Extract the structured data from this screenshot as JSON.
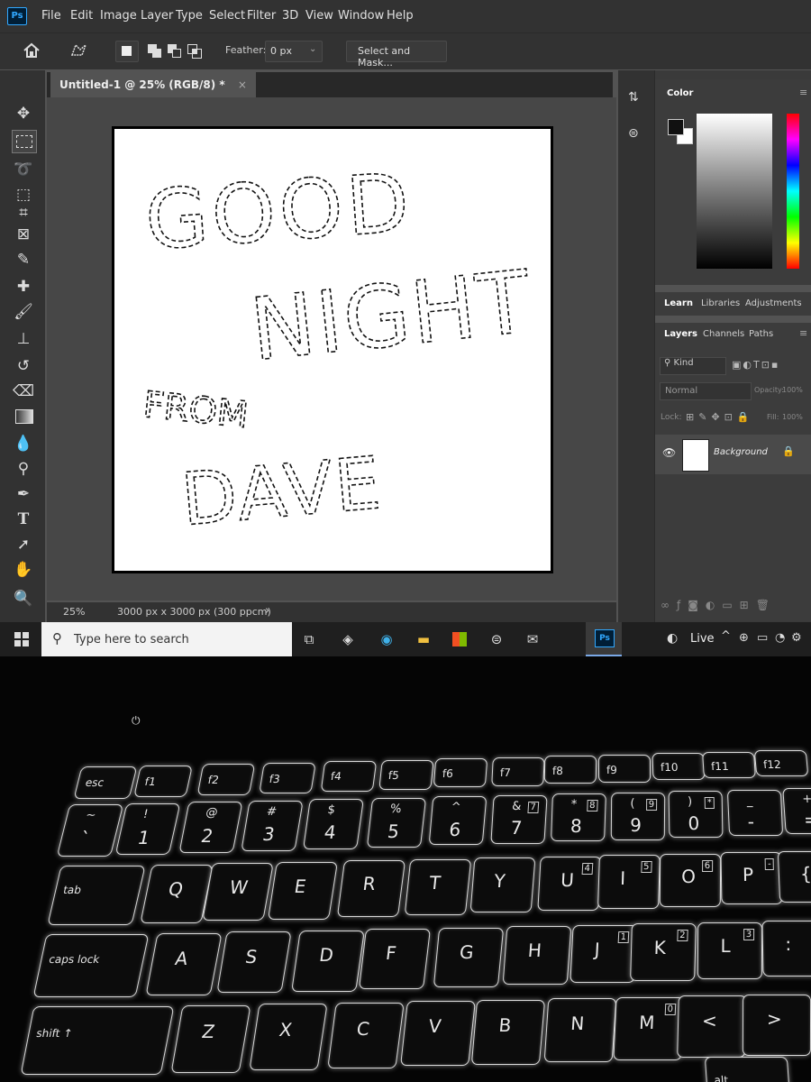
{
  "app": {
    "logo_text": "Ps"
  },
  "menubar": {
    "items": [
      "File",
      "Edit",
      "Image",
      "Layer",
      "Type",
      "Select",
      "Filter",
      "3D",
      "View",
      "Window",
      "Help"
    ]
  },
  "options_bar": {
    "feather_label": "Feather:",
    "feather_value": "0 px",
    "select_mask_label": "Select and Mask..."
  },
  "document": {
    "tab_title": "Untitled-1 @ 25% (RGB/8) *",
    "tab_close": "×",
    "canvas_text": [
      "GOOD",
      "NIGHT",
      "FROM",
      "DAVE"
    ]
  },
  "statusbar": {
    "zoom": "25%",
    "doc_info": "3000 px x 3000 px (300 ppcm)",
    "arrow": "›"
  },
  "panels": {
    "color_tab": "Color",
    "tabs_row1": [
      "Learn",
      "Libraries",
      "Adjustments"
    ],
    "tabs_row2": [
      "Layers",
      "Channels",
      "Paths"
    ],
    "kind_label": "Kind",
    "blend_mode": "Normal",
    "opacity_label": "Opacity:",
    "opacity_value": "100%",
    "lock_label": "Lock:",
    "fill_label": "Fill:",
    "fill_value": "100%",
    "layer_name": "Background"
  },
  "taskbar": {
    "search_placeholder": "Type here to search",
    "weather_label": "Live"
  },
  "keyboard": {
    "row_fn": [
      "esc",
      "f1",
      "f2",
      "f3",
      "f4",
      "f5",
      "f6",
      "f7",
      "f8",
      "f9",
      "f10",
      "f11",
      "f12"
    ],
    "row_num": [
      [
        "~",
        "`"
      ],
      [
        "!",
        "1"
      ],
      [
        "@",
        "2"
      ],
      [
        "#",
        "3"
      ],
      [
        "$",
        "4"
      ],
      [
        "%",
        "5"
      ],
      [
        "^",
        "6"
      ],
      [
        "&",
        "7"
      ],
      [
        "*",
        "8"
      ],
      [
        "(",
        "9"
      ],
      [
        ")",
        "0"
      ],
      [
        "_",
        "-"
      ],
      [
        "+",
        "="
      ]
    ],
    "row_top": [
      "tab",
      "Q",
      "W",
      "E",
      "R",
      "T",
      "Y",
      "U",
      "I",
      "O",
      "P",
      "{"
    ],
    "row_home": [
      "caps lock",
      "A",
      "S",
      "D",
      "F",
      "G",
      "H",
      "J",
      "K",
      "L",
      ":"
    ],
    "row_bottom": [
      "shift ↑",
      "Z",
      "X",
      "C",
      "V",
      "B",
      "N",
      "M",
      "<",
      ">"
    ],
    "alt_label": "alt",
    "numpad_overlays": {
      "7": "7",
      "8": "8",
      "9": "9",
      "0": "*",
      "U": "4",
      "I": "5",
      "O": "6",
      "P": "-",
      "J": "1",
      "K": "2",
      "L": "3",
      "M": "0"
    }
  },
  "colors": {
    "ps_blue": "#31a8ff",
    "panel_bg": "#535353",
    "menubar_bg": "#323232"
  }
}
